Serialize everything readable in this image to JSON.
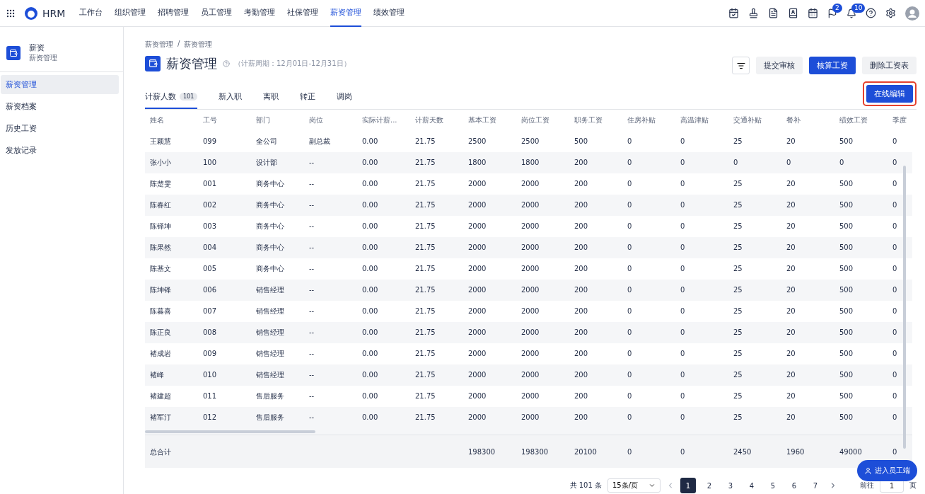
{
  "topnav": {
    "brand": "HRM",
    "items": [
      {
        "label": "工作台",
        "selected": false
      },
      {
        "label": "组织管理",
        "selected": false
      },
      {
        "label": "招聘管理",
        "selected": false
      },
      {
        "label": "员工管理",
        "selected": false
      },
      {
        "label": "考勤管理",
        "selected": false
      },
      {
        "label": "社保管理",
        "selected": false
      },
      {
        "label": "薪资管理",
        "selected": true
      },
      {
        "label": "绩效管理",
        "selected": false
      }
    ],
    "flag_badge": "2",
    "bell_badge": "10"
  },
  "sidebar": {
    "title": "薪资",
    "subtitle": "薪资管理",
    "items": [
      {
        "label": "薪资管理",
        "selected": true
      },
      {
        "label": "薪资档案",
        "selected": false
      },
      {
        "label": "历史工资",
        "selected": false
      },
      {
        "label": "发放记录",
        "selected": false
      }
    ]
  },
  "breadcrumb": {
    "items": [
      "薪资管理",
      "薪资管理"
    ],
    "separator": "/"
  },
  "page": {
    "title": "薪资管理",
    "period": "（计薪周期：12月01日-12月31日）"
  },
  "actions": [
    {
      "label": "提交审核",
      "primary": false
    },
    {
      "label": "核算工资",
      "primary": true
    },
    {
      "label": "删除工资表",
      "primary": false
    }
  ],
  "tabs": [
    {
      "label": "计薪人数",
      "count": "101",
      "selected": true
    },
    {
      "label": "新入职",
      "selected": false
    },
    {
      "label": "离职",
      "selected": false
    },
    {
      "label": "转正",
      "selected": false
    },
    {
      "label": "调岗",
      "selected": false
    }
  ],
  "edit_button": {
    "label": "在线编辑",
    "highlighted": true
  },
  "table": {
    "columns": [
      "姓名",
      "工号",
      "部门",
      "岗位",
      "实际计薪...",
      "计薪天数",
      "基本工资",
      "岗位工资",
      "职务工资",
      "住房补贴",
      "高温津贴",
      "交通补贴",
      "餐补",
      "绩效工资",
      "季度"
    ],
    "rows": [
      [
        "王颖慧",
        "099",
        "全公司",
        "副总裁",
        "0.00",
        "21.75",
        "2500",
        "2500",
        "500",
        "0",
        "0",
        "25",
        "20",
        "500",
        "0"
      ],
      [
        "张小小",
        "100",
        "设计部",
        "--",
        "0.00",
        "21.75",
        "1800",
        "1800",
        "200",
        "0",
        "0",
        "0",
        "0",
        "0",
        "0"
      ],
      [
        "陈楚雯",
        "001",
        "商务中心",
        "--",
        "0.00",
        "21.75",
        "2000",
        "2000",
        "200",
        "0",
        "0",
        "25",
        "20",
        "500",
        "0"
      ],
      [
        "陈春红",
        "002",
        "商务中心",
        "--",
        "0.00",
        "21.75",
        "2000",
        "2000",
        "200",
        "0",
        "0",
        "25",
        "20",
        "500",
        "0"
      ],
      [
        "陈铎坤",
        "003",
        "商务中心",
        "--",
        "0.00",
        "21.75",
        "2000",
        "2000",
        "200",
        "0",
        "0",
        "25",
        "20",
        "500",
        "0"
      ],
      [
        "陈果然",
        "004",
        "商务中心",
        "--",
        "0.00",
        "21.75",
        "2000",
        "2000",
        "200",
        "0",
        "0",
        "25",
        "20",
        "500",
        "0"
      ],
      [
        "陈基文",
        "005",
        "商务中心",
        "--",
        "0.00",
        "21.75",
        "2000",
        "2000",
        "200",
        "0",
        "0",
        "25",
        "20",
        "500",
        "0"
      ],
      [
        "陈坤锋",
        "006",
        "销售经理",
        "--",
        "0.00",
        "21.75",
        "2000",
        "2000",
        "200",
        "0",
        "0",
        "25",
        "20",
        "500",
        "0"
      ],
      [
        "陈暮喜",
        "007",
        "销售经理",
        "--",
        "0.00",
        "21.75",
        "2000",
        "2000",
        "200",
        "0",
        "0",
        "25",
        "20",
        "500",
        "0"
      ],
      [
        "陈正良",
        "008",
        "销售经理",
        "--",
        "0.00",
        "21.75",
        "2000",
        "2000",
        "200",
        "0",
        "0",
        "25",
        "20",
        "500",
        "0"
      ],
      [
        "褚成岩",
        "009",
        "销售经理",
        "--",
        "0.00",
        "21.75",
        "2000",
        "2000",
        "200",
        "0",
        "0",
        "25",
        "20",
        "500",
        "0"
      ],
      [
        "褚峰",
        "010",
        "销售经理",
        "--",
        "0.00",
        "21.75",
        "2000",
        "2000",
        "200",
        "0",
        "0",
        "25",
        "20",
        "500",
        "0"
      ],
      [
        "褚建超",
        "011",
        "售后服务",
        "--",
        "0.00",
        "21.75",
        "2000",
        "2000",
        "200",
        "0",
        "0",
        "25",
        "20",
        "500",
        "0"
      ],
      [
        "褚军汀",
        "012",
        "售后服务",
        "--",
        "0.00",
        "21.75",
        "2000",
        "2000",
        "200",
        "0",
        "0",
        "25",
        "20",
        "500",
        "0"
      ]
    ],
    "total": {
      "label": "总合计",
      "values": [
        "198300",
        "198300",
        "20100",
        "0",
        "0",
        "2450",
        "1960",
        "49000",
        "0"
      ]
    }
  },
  "pagination": {
    "total": "共 101 条",
    "page_size": "15条/页",
    "pages": [
      {
        "label": "1",
        "selected": true
      },
      {
        "label": "2",
        "selected": false
      },
      {
        "label": "3",
        "selected": false
      },
      {
        "label": "4",
        "selected": false
      },
      {
        "label": "5",
        "selected": false
      },
      {
        "label": "6",
        "selected": false
      },
      {
        "label": "7",
        "selected": false
      }
    ],
    "goto_label": "前往",
    "goto_value": "1",
    "goto_suffix": "页"
  },
  "float_button": "进入员工端"
}
